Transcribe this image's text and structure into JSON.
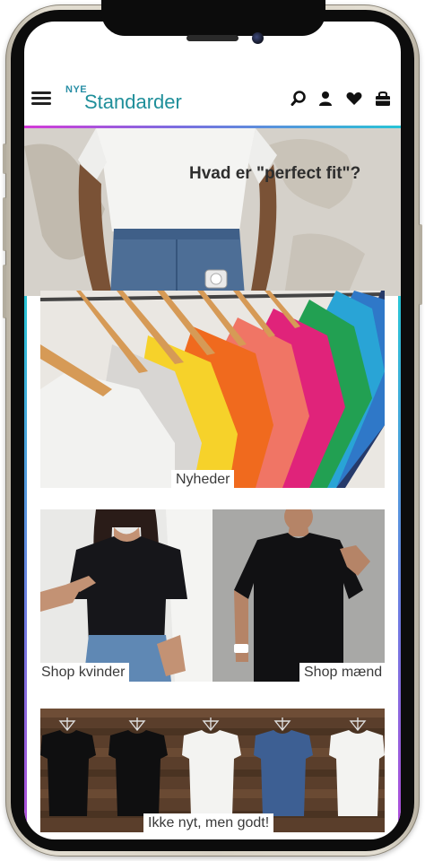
{
  "header": {
    "logo_small": "NYE",
    "logo_big": "Standarder",
    "icons": [
      "menu-icon",
      "search-icon",
      "user-icon",
      "heart-icon",
      "bag-icon"
    ]
  },
  "hero": {
    "title": "Hvad er \"perfect fit\"?"
  },
  "tiles": [
    {
      "label": "Nyheder"
    },
    {
      "label": "Shop kvinder"
    },
    {
      "label": "Shop mænd"
    },
    {
      "label": "Ikke nyt, men godt!"
    }
  ],
  "colors": {
    "brand": "#1f8f9a",
    "accent_gradient_start": "#d43ad8",
    "accent_gradient_end": "#28c4d6"
  }
}
